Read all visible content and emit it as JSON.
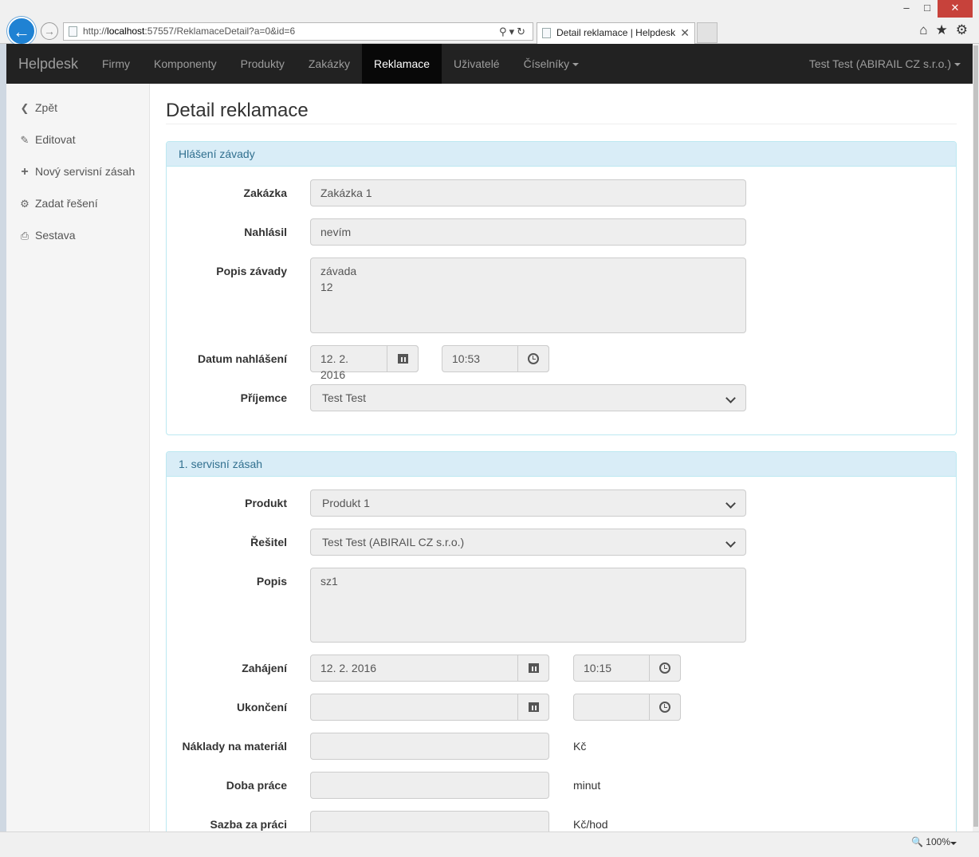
{
  "browser": {
    "address_prefix": "http://",
    "address_host": "localhost",
    "address_rest": ":57557/ReklamaceDetail?a=0&id=6",
    "tab_title": "Detail reklamace | Helpdesk",
    "zoom": "100%"
  },
  "navbar": {
    "brand": "Helpdesk",
    "items": [
      {
        "label": "Firmy"
      },
      {
        "label": "Komponenty"
      },
      {
        "label": "Produkty"
      },
      {
        "label": "Zakázky"
      },
      {
        "label": "Reklamace"
      },
      {
        "label": "Uživatelé"
      },
      {
        "label": "Číselníky"
      }
    ],
    "user": "Test Test (ABIRAIL CZ s.r.o.)"
  },
  "sidebar": {
    "items": [
      {
        "label": "Zpět",
        "icon": "chevron-left-icon"
      },
      {
        "label": "Editovat",
        "icon": "edit-icon"
      },
      {
        "label": "Nový servisní zásah",
        "icon": "plus-icon"
      },
      {
        "label": "Zadat řešení",
        "icon": "cog-icon"
      },
      {
        "label": "Sestava",
        "icon": "print-icon"
      }
    ]
  },
  "page": {
    "title": "Detail reklamace"
  },
  "hlaseni": {
    "heading": "Hlášení závady",
    "zakazka_label": "Zakázka",
    "zakazka_value": "Zakázka 1",
    "nahlasil_label": "Nahlásil",
    "nahlasil_value": "nevím",
    "popis_label": "Popis závady",
    "popis_value": "závada\n12",
    "datum_label": "Datum nahlášení",
    "datum_value": "12. 2. 2016",
    "cas_value": "10:53",
    "prijemce_label": "Příjemce",
    "prijemce_value": "Test Test"
  },
  "zasah": {
    "heading": "1. servisní zásah",
    "produkt_label": "Produkt",
    "produkt_value": "Produkt 1",
    "resitel_label": "Řešitel",
    "resitel_value": "Test Test (ABIRAIL CZ s.r.o.)",
    "popis_label": "Popis",
    "popis_value": "sz1",
    "zahajeni_label": "Zahájení",
    "zahajeni_datum": "12. 2. 2016",
    "zahajeni_cas": "10:15",
    "ukonceni_label": "Ukončení",
    "ukonceni_datum": "",
    "ukonceni_cas": "",
    "naklady_label": "Náklady na materiál",
    "naklady_value": "",
    "naklady_unit": "Kč",
    "doba_label": "Doba práce",
    "doba_value": "",
    "doba_unit": "minut",
    "sazba_label": "Sazba za práci",
    "sazba_value": "",
    "sazba_unit": "Kč/hod"
  }
}
